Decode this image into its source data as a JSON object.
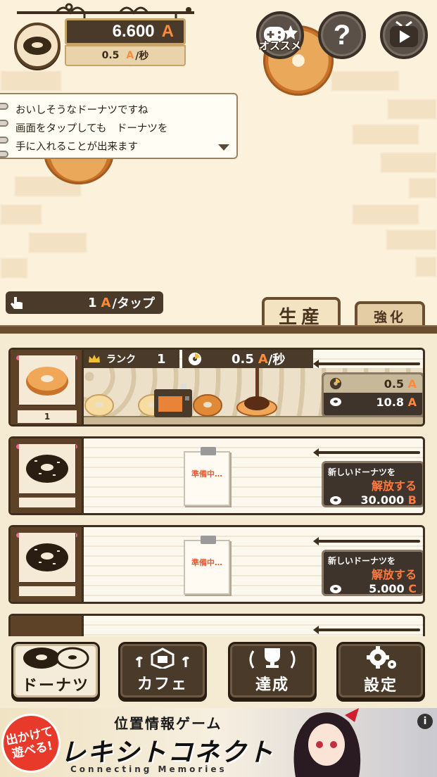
{
  "hud": {
    "money_value": "6.600",
    "money_unit": "A",
    "rate_value": "0.5",
    "rate_unit": "A",
    "rate_suffix": "/秒",
    "osusume_label": "オススメ",
    "help_glyph": "?"
  },
  "tutorial": {
    "lines": [
      "おいしそうなドーナツですね",
      "画面をタップしても　ドーナツを",
      "手に入れることが出来ます"
    ]
  },
  "tap": {
    "value": "1",
    "unit": "A",
    "suffix": "/タップ"
  },
  "tabs": {
    "produce": "生産",
    "upgrade": "強化"
  },
  "rows": [
    {
      "rank_label": "ランク",
      "rank_value": "1",
      "rate_value": "0.5",
      "rate_unit": "A",
      "rate_suffix": "/秒",
      "owned_count": "1",
      "sign_rate": "0.5",
      "sign_rate_unit": "A",
      "sign_cost": "10.8",
      "sign_cost_unit": "A"
    },
    {
      "note_text": "準備中…",
      "unlock_line1": "新しいドーナツを",
      "unlock_line2": "解放する",
      "cost": "30.000",
      "cost_unit": "B"
    },
    {
      "note_text": "準備中…",
      "unlock_line1": "新しいドーナツを",
      "unlock_line2": "解放する",
      "cost": "5.000",
      "cost_unit": "C"
    }
  ],
  "nav": {
    "donut": "ドーナツ",
    "cafe": "カフェ",
    "achievement": "達成",
    "settings": "設定"
  },
  "ad": {
    "badge": "出かけて遊べる!",
    "top_line": "位置情報ゲーム",
    "title": "レキシトコネクト",
    "subtitle": "Connecting Memories",
    "info_glyph": "i"
  },
  "colors": {
    "accent_unit": "#ff8a3a",
    "dark_wood": "#4a3a2a",
    "frame_wood": "#5e4228"
  }
}
